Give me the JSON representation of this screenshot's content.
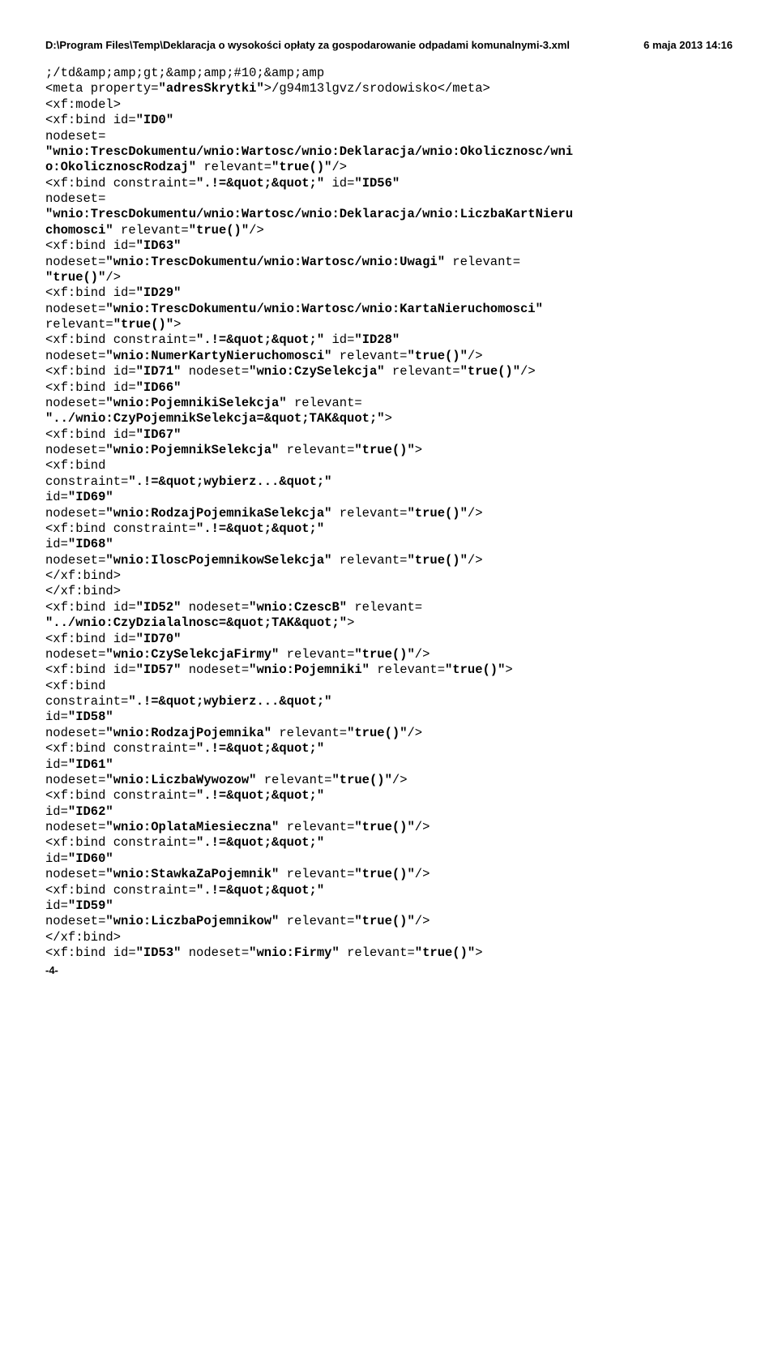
{
  "header": {
    "left": "D:\\Program Files\\Temp\\Deklaracja o wysokości opłaty za gospodarowanie odpadami komunalnymi-3.xml",
    "right": "6 maja 2013 14:16"
  },
  "code": {
    "l1": ";/td&amp;amp;gt;&amp;amp;#10;&amp;amp",
    "l2a": "<meta property=",
    "l2b": "\"adresSkrytki\"",
    "l2c": ">/g94m13lgvz/srodowisko</meta>",
    "l3": "<xf:model>",
    "l4a": "<xf:bind id=",
    "l4b": "\"ID0\"",
    "l5": "nodeset=",
    "l6": "\"wnio:TrescDokumentu/wnio:Wartosc/wnio:Deklaracja/wnio:Okolicznosc/wni",
    "l6b": "o:OkolicznoscRodzaj\"",
    "l6c": " relevant=",
    "l6d": "\"true()\"",
    "l6e": "/>",
    "l7a": "<xf:bind constraint=",
    "l7b": "\".!=&quot;&quot;\"",
    "l7c": " id=",
    "l7d": "\"ID56\"",
    "l8": "nodeset=",
    "l9": "\"wnio:TrescDokumentu/wnio:Wartosc/wnio:Deklaracja/wnio:LiczbaKartNieru",
    "l9b": "chomosci\"",
    "l9c": " relevant=",
    "l9d": "\"true()\"",
    "l9e": "/>",
    "l10a": "<xf:bind id=",
    "l10b": "\"ID63\"",
    "l11a": "nodeset=",
    "l11b": "\"wnio:TrescDokumentu/wnio:Wartosc/wnio:Uwagi\"",
    "l11c": " relevant=",
    "l12a": "\"true()\"",
    "l12b": "/>",
    "l13a": "<xf:bind id=",
    "l13b": "\"ID29\"",
    "l14a": "nodeset=",
    "l14b": "\"wnio:TrescDokumentu/wnio:Wartosc/wnio:KartaNieruchomosci\"",
    "l15a": "relevant=",
    "l15b": "\"true()\"",
    "l15c": ">",
    "l16a": "<xf:bind constraint=",
    "l16b": "\".!=&quot;&quot;\"",
    "l16c": " id=",
    "l16d": "\"ID28\"",
    "l17a": "nodeset=",
    "l17b": "\"wnio:NumerKartyNieruchomosci\"",
    "l17c": " relevant=",
    "l17d": "\"true()\"",
    "l17e": "/>",
    "l18a": "<xf:bind id=",
    "l18b": "\"ID71\"",
    "l18c": " nodeset=",
    "l18d": "\"wnio:CzySelekcja\"",
    "l18e": " relevant=",
    "l18f": "\"true()\"",
    "l18g": "/>",
    "l19a": "<xf:bind id=",
    "l19b": "\"ID66\"",
    "l20a": "nodeset=",
    "l20b": "\"wnio:PojemnikiSelekcja\"",
    "l20c": " relevant=",
    "l21": "\"../wnio:CzyPojemnikSelekcja=&quot;TAK&quot;\"",
    "l21b": ">",
    "l22a": "<xf:bind id=",
    "l22b": "\"ID67\"",
    "l23a": "nodeset=",
    "l23b": "\"wnio:PojemnikSelekcja\"",
    "l23c": " relevant=",
    "l23d": "\"true()\"",
    "l23e": ">",
    "l24": "<xf:bind",
    "l25a": "constraint=",
    "l25b": "\".!=&quot;wybierz...&quot;\"",
    "l26a": "id=",
    "l26b": "\"ID69\"",
    "l27a": "nodeset=",
    "l27b": "\"wnio:RodzajPojemnikaSelekcja\"",
    "l27c": " relevant=",
    "l27d": "\"true()\"",
    "l27e": "/>",
    "l28a": "<xf:bind constraint=",
    "l28b": "\".!=&quot;&quot;\"",
    "l29a": "id=",
    "l29b": "\"ID68\"",
    "l30a": "nodeset=",
    "l30b": "\"wnio:IloscPojemnikowSelekcja\"",
    "l30c": " relevant=",
    "l30d": "\"true()\"",
    "l30e": "/>",
    "l31": "</xf:bind>",
    "l32": "</xf:bind>",
    "l33a": "<xf:bind id=",
    "l33b": "\"ID52\"",
    "l33c": " nodeset=",
    "l33d": "\"wnio:CzescB\"",
    "l33e": " relevant=",
    "l34": "\"../wnio:CzyDzialalnosc=&quot;TAK&quot;\"",
    "l34b": ">",
    "l35a": "<xf:bind id=",
    "l35b": "\"ID70\"",
    "l36a": "nodeset=",
    "l36b": "\"wnio:CzySelekcjaFirmy\"",
    "l36c": " relevant=",
    "l36d": "\"true()\"",
    "l36e": "/>",
    "l37a": "<xf:bind id=",
    "l37b": "\"ID57\"",
    "l37c": " nodeset=",
    "l37d": "\"wnio:Pojemniki\"",
    "l37e": " relevant=",
    "l37f": "\"true()\"",
    "l37g": ">",
    "l38": "<xf:bind",
    "l39a": "constraint=",
    "l39b": "\".!=&quot;wybierz...&quot;\"",
    "l40a": "id=",
    "l40b": "\"ID58\"",
    "l41a": "nodeset=",
    "l41b": "\"wnio:RodzajPojemnika\"",
    "l41c": " relevant=",
    "l41d": "\"true()\"",
    "l41e": "/>",
    "l42a": "<xf:bind constraint=",
    "l42b": "\".!=&quot;&quot;\"",
    "l43a": "id=",
    "l43b": "\"ID61\"",
    "l44a": "nodeset=",
    "l44b": "\"wnio:LiczbaWywozow\"",
    "l44c": " relevant=",
    "l44d": "\"true()\"",
    "l44e": "/>",
    "l45a": "<xf:bind constraint=",
    "l45b": "\".!=&quot;&quot;\"",
    "l46a": "id=",
    "l46b": "\"ID62\"",
    "l47a": "nodeset=",
    "l47b": "\"wnio:OplataMiesieczna\"",
    "l47c": " relevant=",
    "l47d": "\"true()\"",
    "l47e": "/>",
    "l48a": "<xf:bind constraint=",
    "l48b": "\".!=&quot;&quot;\"",
    "l49a": "id=",
    "l49b": "\"ID60\"",
    "l50a": "nodeset=",
    "l50b": "\"wnio:StawkaZaPojemnik\"",
    "l50c": " relevant=",
    "l50d": "\"true()\"",
    "l50e": "/>",
    "l51a": "<xf:bind constraint=",
    "l51b": "\".!=&quot;&quot;\"",
    "l52a": "id=",
    "l52b": "\"ID59\"",
    "l53a": "nodeset=",
    "l53b": "\"wnio:LiczbaPojemnikow\"",
    "l53c": " relevant=",
    "l53d": "\"true()\"",
    "l53e": "/>",
    "l54": "</xf:bind>",
    "l55a": "<xf:bind id=",
    "l55b": "\"ID53\"",
    "l55c": " nodeset=",
    "l55d": "\"wnio:Firmy\"",
    "l55e": " relevant=",
    "l55f": "\"true()\"",
    "l55g": ">"
  },
  "footer": "-4-"
}
